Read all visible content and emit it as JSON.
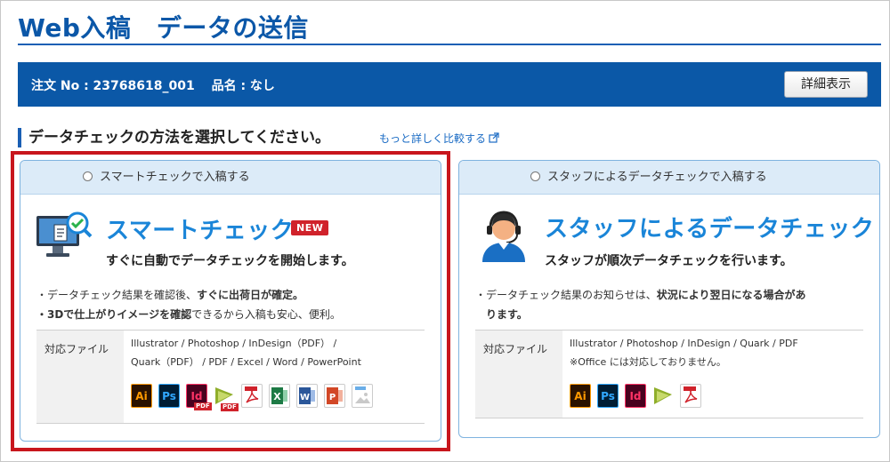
{
  "header": {
    "title": "Web入稿　データの送信"
  },
  "order": {
    "info": "注文 No : 23768618_001　 品名 : なし",
    "detail_button": "詳細表示"
  },
  "section": {
    "heading": "データチェックの方法を選択してください。",
    "compare_link": "もっと詳しく比較する"
  },
  "options": [
    {
      "radio_label": "スマートチェックで入稿する",
      "title": "スマートチェック",
      "badge": "NEW",
      "subtitle": "すぐに自動でデータチェックを開始します。",
      "bullet1_pre": "・データチェック結果を確認後、",
      "bullet1_bold": "すぐに出荷日が確定。",
      "bullet2_bold": "・3Dで仕上がりイメージを確認",
      "bullet2_post": "できるから入稿も安心、便利。",
      "files_label": "対応ファイル",
      "files_line1": "Illustrator / Photoshop / InDesign（PDF） /",
      "files_line2": "Quark（PDF） / PDF / Excel / Word / PowerPoint",
      "file_icons": [
        "Ai",
        "Ps",
        "Id",
        "Quark",
        "PDF",
        "Excel",
        "Word",
        "PowerPoint",
        "IMG"
      ]
    },
    {
      "radio_label": "スタッフによるデータチェックで入稿する",
      "title": "スタッフによるデータチェック",
      "subtitle": "スタッフが順次データチェックを行います。",
      "bullet1_pre": "・データチェック結果のお知らせは、",
      "bullet1_bold": "状況により翌日になる場合があ",
      "bullet1_bold2": "ります。",
      "files_label": "対応ファイル",
      "files_line1": "Illustrator / Photoshop / InDesign / Quark / PDF",
      "files_line2": "※Office には対応しておりません。",
      "file_icons": [
        "Ai",
        "Ps",
        "Id",
        "Quark",
        "PDF"
      ]
    }
  ],
  "colors": {
    "brand_blue": "#0b58a7",
    "accent_blue": "#1a85d8",
    "highlight_red": "#c8161d"
  }
}
